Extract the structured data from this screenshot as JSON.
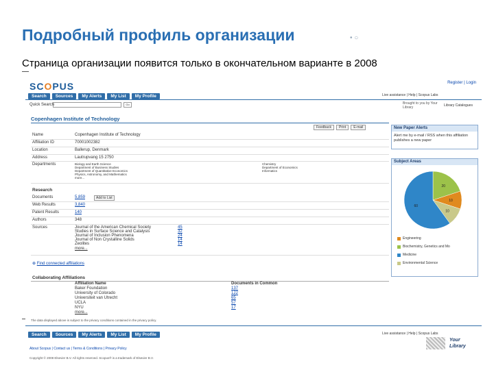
{
  "slide": {
    "title": "Подробный профиль организации",
    "subtitle": "Страница организации появится только в окончательном варианте в 2008"
  },
  "scopus": {
    "logo": "SCOPUS",
    "register": "Register | Login",
    "nav": [
      "Search",
      "Sources",
      "My Alerts",
      "My List",
      "My Profile"
    ],
    "quick_search_label": "Quick Search",
    "go": "Go",
    "help_links": "Live assistance  |  Help  |  Scopus Labs",
    "brought": "Brought to you by Your Library",
    "library_catalogue": "Library Catalogues",
    "profile_title": "Copenhagen Institute of Technology",
    "tools": [
      "Feedback",
      "Print",
      "E-mail"
    ],
    "fields": [
      {
        "label": "Name",
        "value": "Copenhagen Institute of Technology"
      },
      {
        "label": "Affiliation ID",
        "value": "70001002382"
      },
      {
        "label": "Location",
        "value": "Ballerup, Denmark"
      },
      {
        "label": "Address",
        "value": "Lautrupvang 15 2750"
      },
      {
        "label": "Departments",
        "value": ""
      }
    ],
    "departments_left": [
      "Biology and Earth Science",
      "Department of Business Studies",
      "Department of Quantitative Economics",
      "Physics, Astronomy, and Mathematics",
      "more..."
    ],
    "departments_right": [
      "Chemistry",
      "Department of Economics",
      "Informatics"
    ],
    "research_header": "Research",
    "research": [
      {
        "label": "Documents",
        "value": "5,859"
      },
      {
        "label": "Web Results",
        "value": "3,840"
      },
      {
        "label": "Patent Results",
        "value": "140"
      },
      {
        "label": "Authors",
        "value": "348"
      },
      {
        "label": "Sources",
        "value": ""
      }
    ],
    "add_to_list": "Add to List",
    "sources": [
      {
        "name": "Journal of the American Chemical Society",
        "count": "45"
      },
      {
        "name": "Studies in Surface Science and Catalysis",
        "count": "32"
      },
      {
        "name": "Journal of Inclusion Phenomena",
        "count": "24"
      },
      {
        "name": "Journal of Non Crystalline Solids",
        "count": "14"
      },
      {
        "name": "Zeolites",
        "count": "14"
      }
    ],
    "sources_more": "more...",
    "find_more": "Find connected affiliations",
    "collab_header": "Collaborating Affiliations",
    "collab_cols": [
      "Affiliation Name",
      "Documents in Common"
    ],
    "collab": [
      {
        "name": "Baker Foundation",
        "count": "137"
      },
      {
        "name": "University of Colorado",
        "count": "122"
      },
      {
        "name": "Universiteit van Utrecht",
        "count": "65"
      },
      {
        "name": "UCLA",
        "count": "57"
      },
      {
        "name": "NYU",
        "count": "17"
      }
    ],
    "collab_more": "more...",
    "privacy_note": "The data displayed above is subject to the privacy conditions contained in the privacy policy.",
    "alerts_header": "New Paper Alerts",
    "alerts_text": "Alert me by e-mail / RSS when this affiliation publishes a new paper",
    "subject_header": "Subject Areas",
    "pie_labels": [
      "20",
      "10",
      "10",
      "60"
    ],
    "legend": [
      {
        "label": "Engineering",
        "color": "#e08a1e"
      },
      {
        "label": "Biochemistry, Genetics and Mo",
        "color": "#9cc24a"
      },
      {
        "label": "Medicine",
        "color": "#2f86c8"
      },
      {
        "label": "Environmental Science",
        "color": "#c9c98a"
      }
    ],
    "bottom_links": "About Scopus  |  Contact us  |  Terms & Conditions  |  Privacy Policy",
    "copyright": "Copyright © 2008 Elsevier B.V. All rights reserved. Scopus® is a trademark of Elsevier B.V.",
    "your_library": "Your Library"
  },
  "chart_data": {
    "type": "pie",
    "categories": [
      "Biochemistry, Genetics and Mo",
      "Engineering",
      "Environmental Science",
      "Medicine"
    ],
    "values": [
      20,
      10,
      10,
      60
    ]
  }
}
